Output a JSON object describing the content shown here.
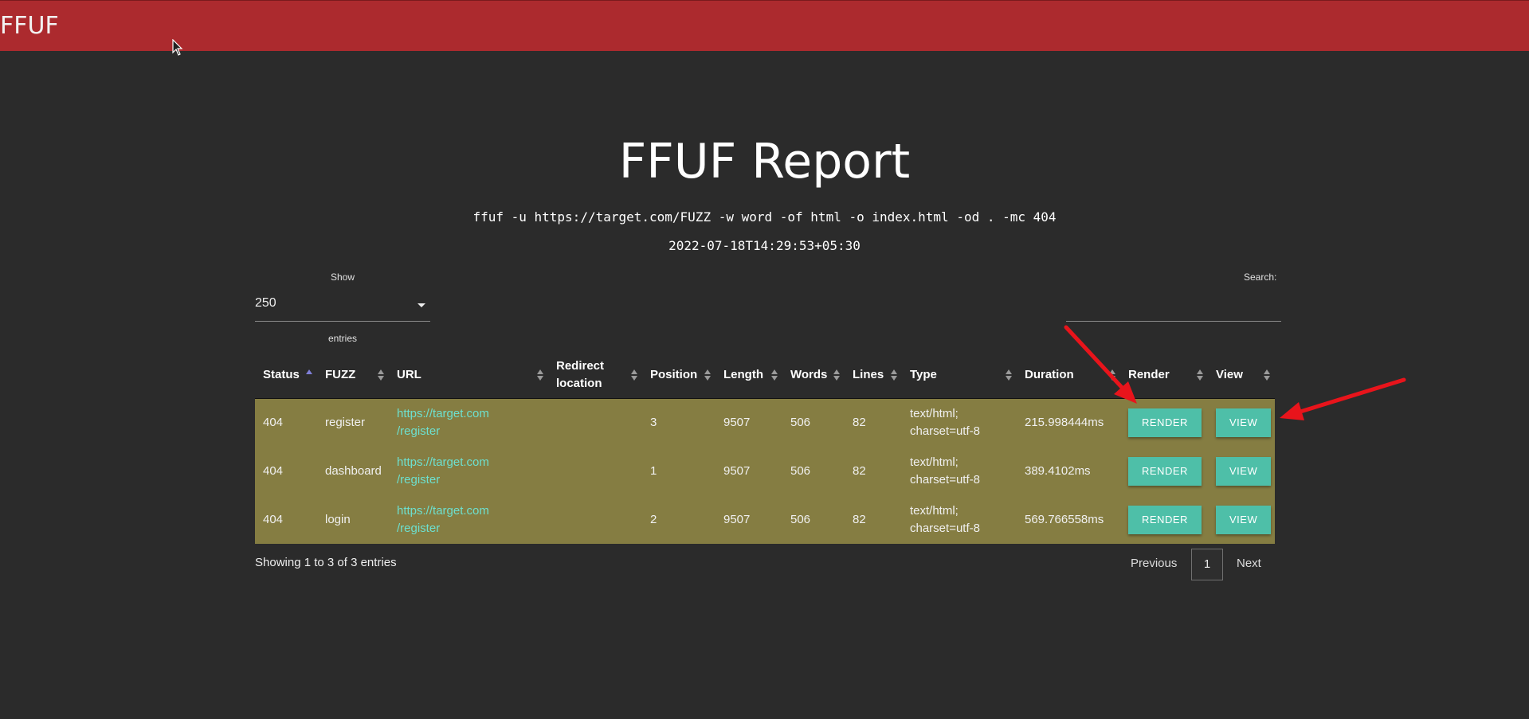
{
  "navbar": {
    "brand": "FFUF"
  },
  "report": {
    "title": "FFUF Report",
    "command": "ffuf -u https://target.com/FUZZ -w word -of html -o index.html -od . -mc 404",
    "timestamp": "2022-07-18T14:29:53+05:30"
  },
  "controls": {
    "show_label": "Show",
    "entries_value": "250",
    "entries_label": "entries",
    "search_label": "Search:",
    "search_value": ""
  },
  "table": {
    "columns": [
      "Status",
      "FUZZ",
      "URL",
      "Redirect location",
      "Position",
      "Length",
      "Words",
      "Lines",
      "Type",
      "Duration",
      "Render",
      "View"
    ],
    "rows": [
      {
        "status": "404",
        "fuzz": "register",
        "url_1": "https://target.com",
        "url_2": "/register",
        "redirect": "",
        "position": "3",
        "length": "9507",
        "words": "506",
        "lines": "82",
        "type_1": "text/html;",
        "type_2": "charset=utf-8",
        "duration": "215.998444ms",
        "render": "RENDER",
        "view": "VIEW"
      },
      {
        "status": "404",
        "fuzz": "dashboard",
        "url_1": "https://target.com",
        "url_2": "/register",
        "redirect": "",
        "position": "1",
        "length": "9507",
        "words": "506",
        "lines": "82",
        "type_1": "text/html;",
        "type_2": "charset=utf-8",
        "duration": "389.4102ms",
        "render": "RENDER",
        "view": "VIEW"
      },
      {
        "status": "404",
        "fuzz": "login",
        "url_1": "https://target.com",
        "url_2": "/register",
        "redirect": "",
        "position": "2",
        "length": "9507",
        "words": "506",
        "lines": "82",
        "type_1": "text/html;",
        "type_2": "charset=utf-8",
        "duration": "569.766558ms",
        "render": "RENDER",
        "view": "VIEW"
      }
    ]
  },
  "footer": {
    "info": "Showing 1 to 3 of 3 entries",
    "previous": "Previous",
    "page": "1",
    "next": "Next"
  },
  "colors": {
    "navbar": "#ac2a2e",
    "background": "#2b2b2b",
    "row_highlight": "#857d42",
    "button": "#4ebfa8",
    "link": "#6de0cf",
    "annotation_arrow": "#e8141b"
  },
  "icons": [
    "mouse-cursor-icon",
    "dropdown-caret-icon",
    "sort-icon",
    "annotation-arrow-icon"
  ]
}
